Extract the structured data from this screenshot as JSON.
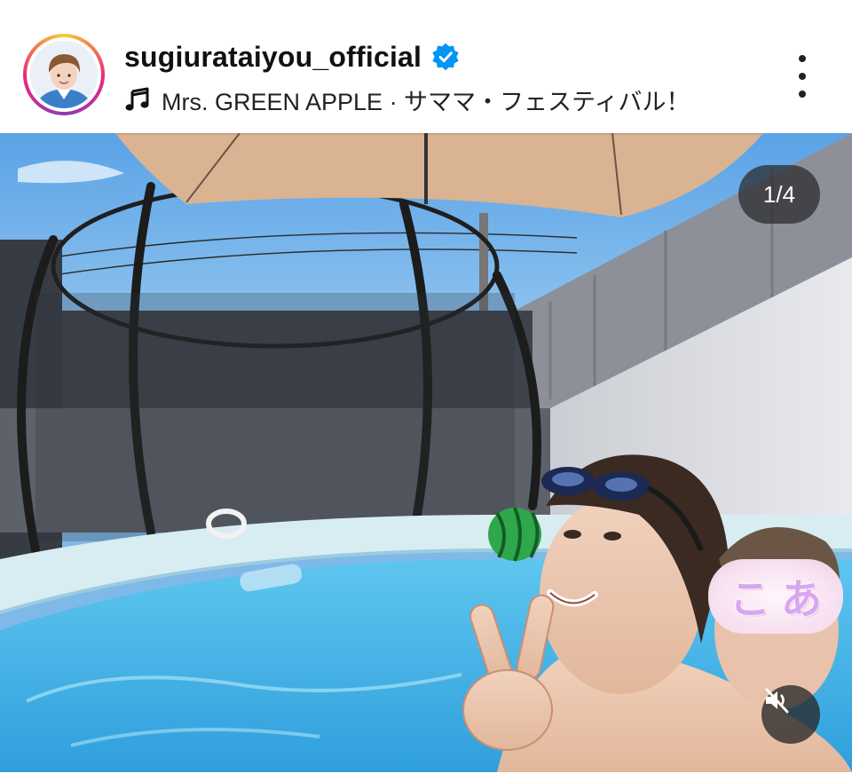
{
  "post": {
    "username": "sugiurataiyou_official",
    "music": "Mrs. GREEN APPLE · サママ・フェスティバル！",
    "image_counter": "1/4",
    "sticker_chars": [
      "こ",
      "あ"
    ]
  },
  "icons": {
    "verified": "verified-badge-icon",
    "music": "music-note-icon",
    "more": "more-vertical-icon",
    "mute": "speaker-muted-icon"
  },
  "colors": {
    "verified": "#0095f6",
    "text": "#111111",
    "counter_bg": "#282828"
  }
}
